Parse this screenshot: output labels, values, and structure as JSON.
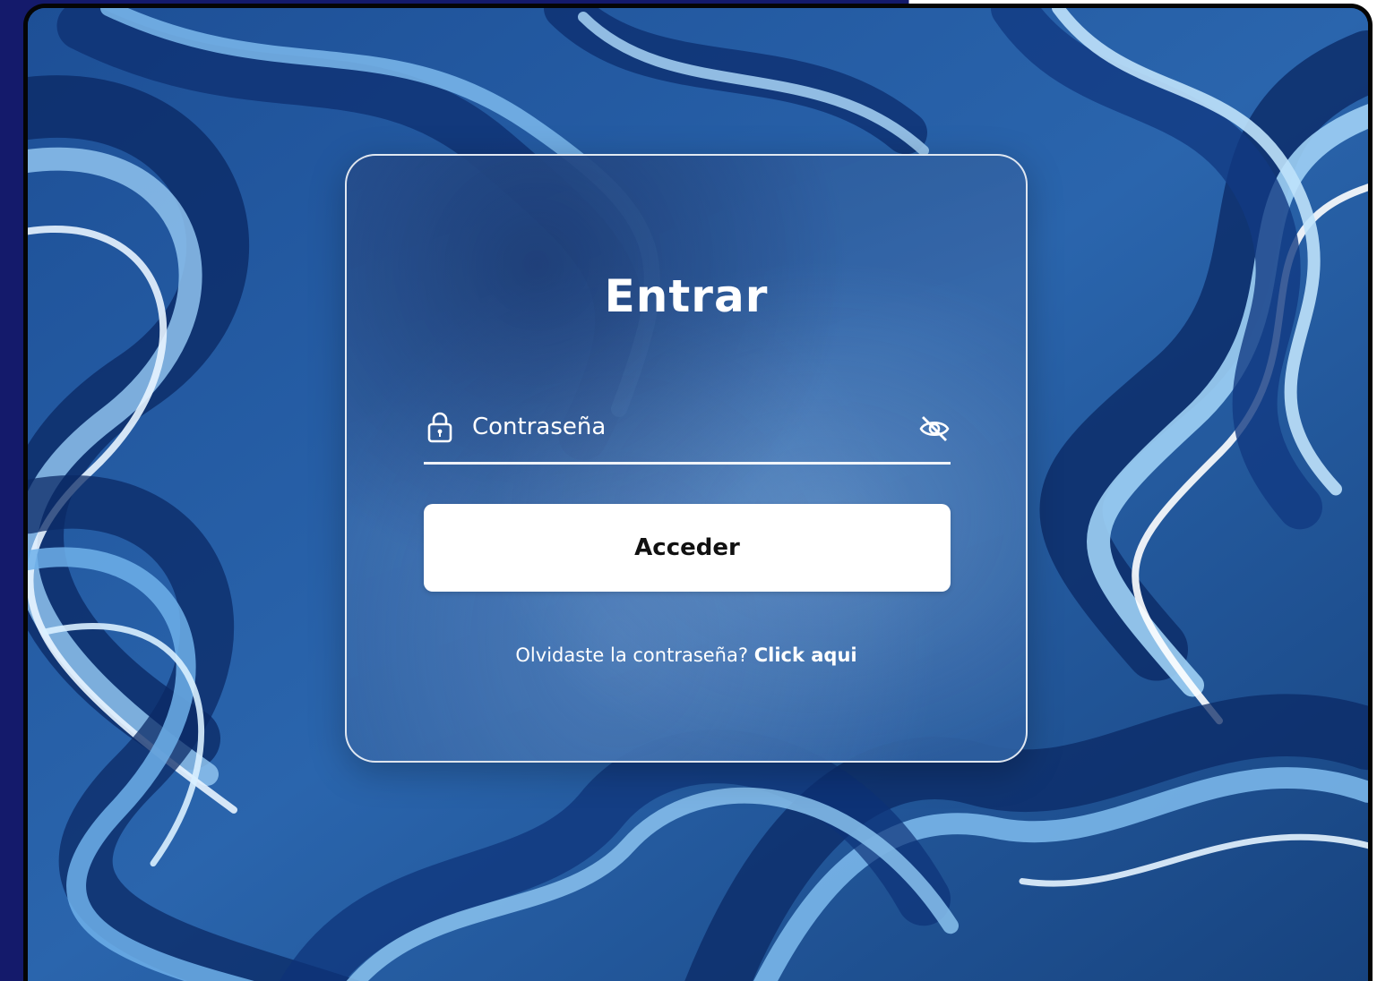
{
  "login": {
    "title": "Entrar",
    "password_placeholder": "Contraseña",
    "submit_label": "Acceder",
    "forgot_text": "Olvidaste la contraseña?",
    "forgot_link": "Click aqui"
  },
  "icons": {
    "lock": "lock-icon",
    "toggle_visibility": "eye-slash-icon"
  },
  "colors": {
    "page_background": "#141a6b",
    "frame_border": "#050505",
    "swirl_dark": "#0b2a66",
    "swirl_mid": "#2f6fb8",
    "swirl_light": "#8fc3ee",
    "button_background": "#ffffff",
    "text_light": "#ffffff",
    "text_dark": "#111111"
  }
}
